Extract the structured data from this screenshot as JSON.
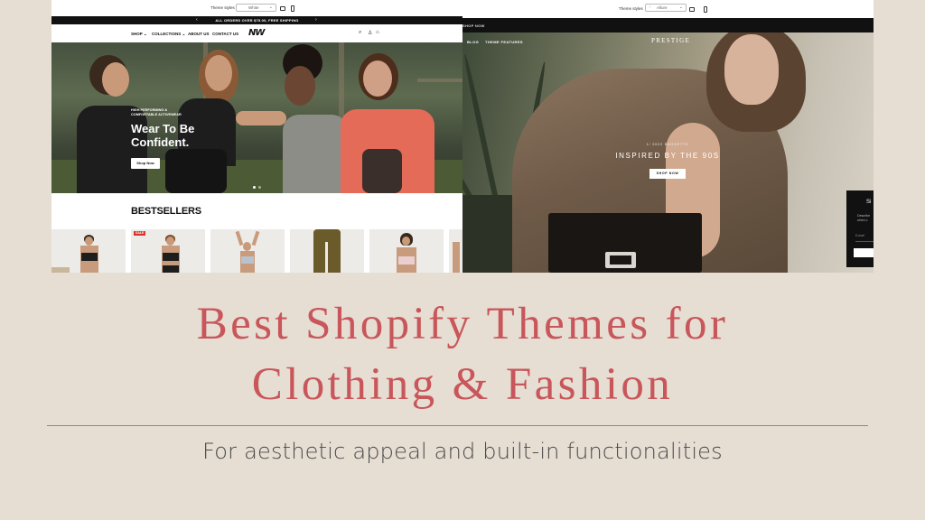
{
  "left_screenshot": {
    "theme_style_label": "Theme styles",
    "theme_style_value": "White",
    "announcement": "ALL ORDERS OVER $75.00, FREE SHIPPING",
    "nav": [
      "SHOP",
      "COLLECTIONS",
      "ABOUT US",
      "CONTACT US"
    ],
    "logo": "NW",
    "hero": {
      "eyebrow_line1": "HIGH PERFORMING &",
      "eyebrow_line2": "COMFORTABLE ACTIVEWEAR",
      "title_line1": "Wear To Be",
      "title_line2": "Confident.",
      "button": "Shop Now"
    },
    "section_title": "BESTSELLERS",
    "sale_badge": "SALE"
  },
  "right_screenshot": {
    "theme_style_label": "Theme styles",
    "theme_style_value": "Allure",
    "shop_now_bar": "SHOP NOW",
    "nav": [
      "BLOG",
      "THEME FEATURES"
    ],
    "logo": "PRESTIGE",
    "hero": {
      "eyebrow": "1/ 2022 BAGSETTE",
      "title": "INSPIRED BY THE 90S",
      "button": "SHOP NOW"
    },
    "popup": {
      "title": "Si",
      "desc_line1": "Describe",
      "desc_line2": "when c",
      "email_placeholder": "E-mail"
    }
  },
  "headline": {
    "line1": "Best Shopify Themes for",
    "line2": "Clothing & Fashion"
  },
  "subtitle": "For aesthetic appeal and built-in functionalities",
  "colors": {
    "background": "#e6ddd3",
    "title": "#c8565a",
    "subtitle": "#4a4a48"
  }
}
